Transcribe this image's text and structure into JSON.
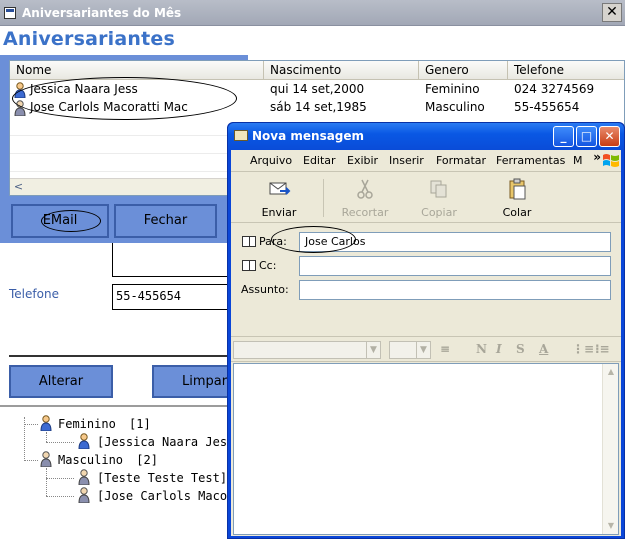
{
  "main_window": {
    "title": "Aniversariantes do Mês",
    "close_glyph": "✕",
    "heading": "Aniversariantes"
  },
  "listview": {
    "columns": [
      "Nome",
      "Nascimento",
      "Genero",
      "Telefone"
    ],
    "rows": [
      {
        "nome": "Jessica Naara Jess",
        "nascimento": "qui 14 set,2000",
        "genero": "Feminino",
        "telefone": "024 3274569"
      },
      {
        "nome": "Jose Carlols Macoratti Mac",
        "nascimento": "sáb 14 set,1985",
        "genero": "Masculino",
        "telefone": "55-455654"
      }
    ],
    "scroll_left_glyph": "<"
  },
  "buttons": {
    "email": "EMail",
    "fechar": "Fechar",
    "alterar": "Alterar",
    "limpar": "Limpar"
  },
  "form": {
    "telefone_label": "Telefone",
    "telefone_value": "55-455654"
  },
  "tree": {
    "feminino_label": "Feminino",
    "feminino_count": "[1]",
    "feminino_child": "[Jessica Naara Jess",
    "masculino_label": "Masculino",
    "masculino_count": "[2]",
    "masculino_child_1": "[Teste Teste Test]",
    "masculino_child_2": "[Jose Carlols Macor"
  },
  "message_window": {
    "title": "Nova mensagem",
    "minimize_glyph": "_",
    "maximize_glyph": "□",
    "close_glyph": "✕",
    "menu": [
      "Arquivo",
      "Editar",
      "Exibir",
      "Inserir",
      "Formatar",
      "Ferramentas",
      "M"
    ],
    "menu_more_glyph": "»",
    "toolbar": {
      "enviar": "Enviar",
      "recortar": "Recortar",
      "copiar": "Copiar",
      "colar": "Colar"
    },
    "fields": {
      "para_label": "Para:",
      "para_value": "Jose Carlos",
      "cc_label": "Cc:",
      "cc_value": "",
      "assunto_label": "Assunto:",
      "assunto_value": ""
    },
    "format_glyphs": {
      "bold": "N",
      "italic": "I",
      "underline": "S",
      "color": "A",
      "numbered": "⋮≡",
      "bullets": "⁝≡",
      "style": "≡"
    },
    "scroll_up_glyph": "▲",
    "scroll_down_glyph": "▼",
    "dropdown_glyph": "▼"
  }
}
